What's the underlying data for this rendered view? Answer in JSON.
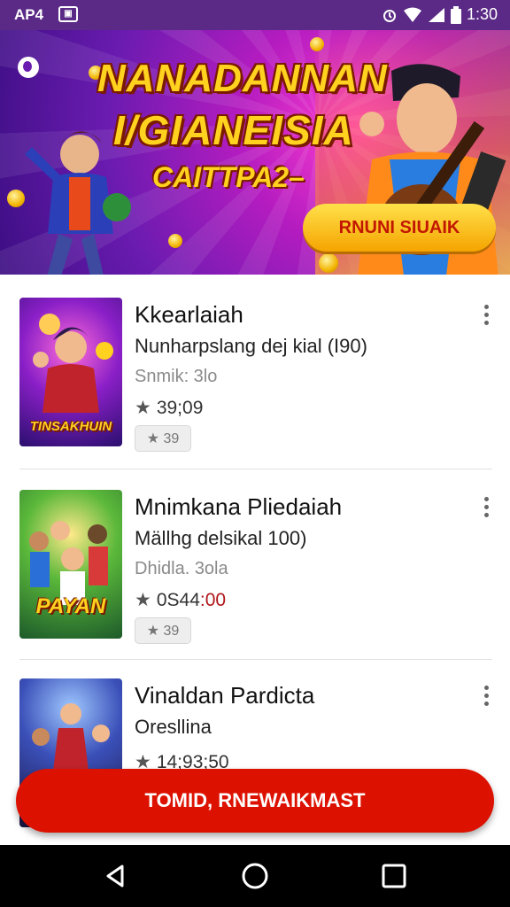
{
  "status_bar": {
    "carrier": "AP4",
    "time": "1:30",
    "icons": [
      "sim-icon",
      "alarm-icon",
      "wifi-icon",
      "signal-icon",
      "battery-icon"
    ]
  },
  "banner": {
    "title_line1": "NANADANNAN",
    "title_line2": "I/GIANEISIA",
    "subtitle": "CAITTPA2–",
    "cta": "RNUNI SIUAIK",
    "colors": {
      "bg": "#6a1bb0",
      "accent": "#ffd21f",
      "cta_text": "#c21700"
    }
  },
  "games": [
    {
      "title": "Kkearlaiah",
      "subtitle": "Nunharpslang dej kial (I90)",
      "meta": "Snmik: 3lo",
      "rating": "39;09",
      "badge": "39",
      "thumb_label": "TINSAKHUIN"
    },
    {
      "title": "Mnimkana Pliedaiah",
      "subtitle": "Mällhg delsikal 100)",
      "meta": "Dhidla. 3ola",
      "rating_prefix": "0S44",
      "rating_suffix": ":00",
      "badge": "39",
      "thumb_label": "PAYAN"
    },
    {
      "title": "Vinaldan Pardicta",
      "subtitle": "Oresllina",
      "rating": "14;93;50"
    }
  ],
  "bottom_cta": "TOMID, RNEWAIKMAST",
  "nav": {
    "icons": [
      "back-icon",
      "home-icon",
      "recents-icon"
    ]
  }
}
